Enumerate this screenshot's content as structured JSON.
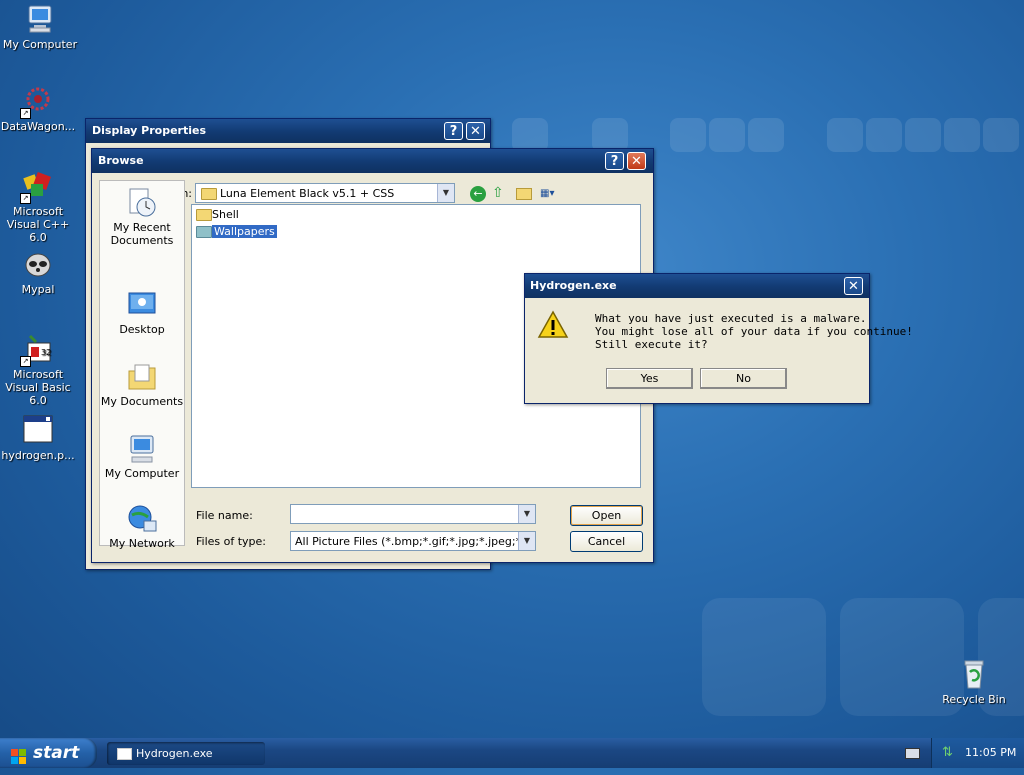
{
  "desktop": {
    "icons": [
      {
        "label": "My Computer"
      },
      {
        "label": "DataWagon..."
      },
      {
        "label": "Microsoft Visual C++ 6.0"
      },
      {
        "label": "Mypal"
      },
      {
        "label": "Microsoft Visual Basic 6.0"
      },
      {
        "label": "hydrogen.p..."
      },
      {
        "label": "Recycle Bin"
      }
    ]
  },
  "display_properties": {
    "title": "Display Properties"
  },
  "browse": {
    "title": "Browse",
    "look_in_label": "Look in:",
    "look_in_value": "Luna Element Black v5.1 + CSS",
    "places": [
      {
        "label": "My Recent Documents"
      },
      {
        "label": "Desktop"
      },
      {
        "label": "My Documents"
      },
      {
        "label": "My Computer"
      },
      {
        "label": "My Network"
      }
    ],
    "files": [
      {
        "name": "Shell",
        "selected": false
      },
      {
        "name": "Wallpapers",
        "selected": true
      }
    ],
    "file_name_label": "File name:",
    "file_name_value": "",
    "file_type_label": "Files of type:",
    "file_type_value": "All Picture Files (*.bmp;*.gif;*.jpg;*.jpeg;*.dib;*.pr",
    "open_label": "Open",
    "cancel_label": "Cancel"
  },
  "alert": {
    "title": "Hydrogen.exe",
    "message_lines": [
      "What you have just executed is a malware.",
      "You might lose all of your data if you continue!",
      "Still execute it?"
    ],
    "yes_label": "Yes",
    "no_label": "No"
  },
  "taskbar": {
    "start_label": "start",
    "task_label": "Hydrogen.exe",
    "clock": "11:05 PM"
  },
  "colors": {
    "title_blue": "#123a72",
    "accent_orange": "#e3a34b"
  }
}
